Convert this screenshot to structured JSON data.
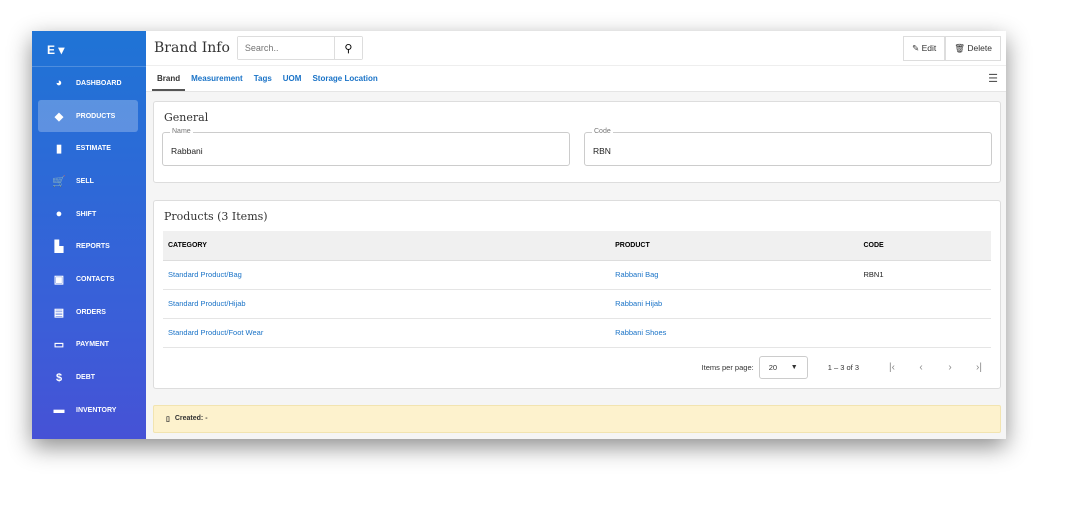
{
  "sidebar": {
    "brand": "E ▾",
    "items": [
      {
        "label": "DASHBOARD",
        "icon": "pie-chart-icon",
        "glyph": "◕"
      },
      {
        "label": "PRODUCTS",
        "icon": "tag-icon",
        "glyph": "◆",
        "active": true
      },
      {
        "label": "ESTIMATE",
        "icon": "clipboard-icon",
        "glyph": "▮"
      },
      {
        "label": "SELL",
        "icon": "cart-icon",
        "glyph": "🛒"
      },
      {
        "label": "SHIFT",
        "icon": "user-clock-icon",
        "glyph": "●"
      },
      {
        "label": "REPORTS",
        "icon": "bar-chart-icon",
        "glyph": "▙"
      },
      {
        "label": "CONTACTS",
        "icon": "address-book-icon",
        "glyph": "▣"
      },
      {
        "label": "ORDERS",
        "icon": "file-icon",
        "glyph": "▤"
      },
      {
        "label": "PAYMENT",
        "icon": "money-icon",
        "glyph": "▭"
      },
      {
        "label": "DEBT",
        "icon": "dollar-icon",
        "glyph": "$"
      },
      {
        "label": "INVENTORY",
        "icon": "archive-icon",
        "glyph": "▬"
      }
    ]
  },
  "header": {
    "title": "Brand Info",
    "search_placeholder": "Search..",
    "edit": "✎ Edit",
    "delete": "🗑 Delete"
  },
  "tabs": [
    {
      "label": "Brand",
      "active": true
    },
    {
      "label": "Measurement"
    },
    {
      "label": "Tags"
    },
    {
      "label": "UOM"
    },
    {
      "label": "Storage Location"
    }
  ],
  "general": {
    "title": "General",
    "name_label": "Name",
    "name": "Rabbani",
    "code_label": "Code",
    "code": "RBN"
  },
  "products": {
    "title": "Products (3 Items)",
    "columns": [
      "CATEGORY",
      "PRODUCT",
      "CODE"
    ],
    "rows": [
      [
        "Standard Product/Bag",
        "Rabbani Bag",
        "RBN1"
      ],
      [
        "Standard Product/Hijab",
        "Rabbani Hijab",
        ""
      ],
      [
        "Standard Product/Foot Wear",
        "Rabbani Shoes",
        ""
      ]
    ],
    "items_per_page_label": "Items per page:",
    "items_per_page": "20",
    "range": "1 – 3 of 3"
  },
  "footer": {
    "created": "Created: -"
  }
}
